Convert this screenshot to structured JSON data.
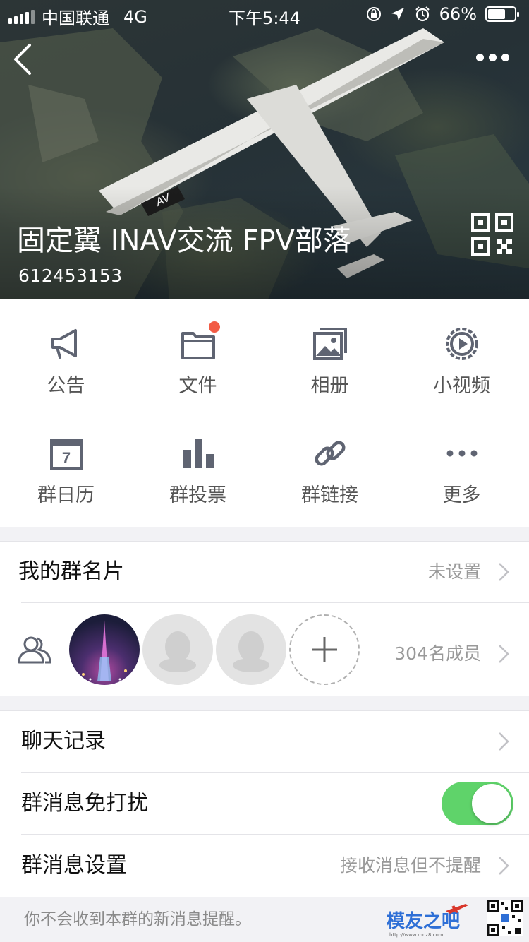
{
  "status_bar": {
    "carrier": "中国联通",
    "network": "4G",
    "time": "下午5:44",
    "battery": "66%",
    "battery_level": 0.66
  },
  "header": {
    "group_name": "固定翼 INAV交流 FPV部落",
    "group_id": "612453153",
    "plane_marking": "AV"
  },
  "features": [
    {
      "label": "公告",
      "icon": "megaphone-icon"
    },
    {
      "label": "文件",
      "icon": "folder-icon",
      "badge": true
    },
    {
      "label": "相册",
      "icon": "photo-album-icon"
    },
    {
      "label": "小视频",
      "icon": "video-play-icon"
    },
    {
      "label": "群日历",
      "icon": "calendar-icon",
      "icon_text": "7"
    },
    {
      "label": "群投票",
      "icon": "bar-chart-icon"
    },
    {
      "label": "群链接",
      "icon": "link-icon"
    },
    {
      "label": "更多",
      "icon": "more-dots-icon"
    }
  ],
  "card": {
    "label": "我的群名片",
    "value": "未设置"
  },
  "members": {
    "count_label": "304名成员",
    "icon": "members-icon"
  },
  "settings": [
    {
      "label": "聊天记录",
      "value": ""
    },
    {
      "label": "群消息免打扰",
      "toggle": true
    },
    {
      "label": "群消息设置",
      "value": "接收消息但不提醒"
    }
  ],
  "footer": {
    "note": "你不会收到本群的新消息提醒。"
  },
  "watermark": {
    "text": "模友之吧",
    "url": "http://www.moz8.com"
  },
  "colors": {
    "accent_green": "#5fd36a",
    "badge_red": "#f25b45",
    "icon_gray": "#5f6472"
  }
}
